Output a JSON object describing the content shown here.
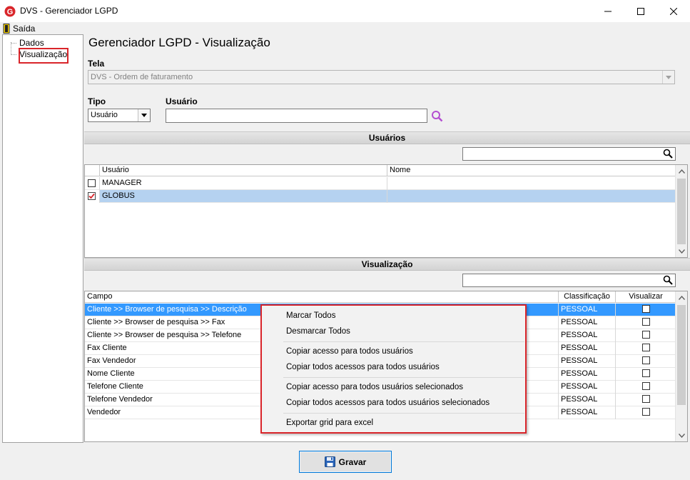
{
  "window": {
    "title": "DVS - Gerenciador LGPD",
    "minimize_icon": "minimize-icon",
    "maximize_icon": "maximize-icon",
    "close_icon": "close-icon",
    "app_icon_letter": "G"
  },
  "menu": {
    "exit_label": "Saída"
  },
  "tree": {
    "items": [
      {
        "label": "Dados"
      },
      {
        "label": "Visualização",
        "selected": true
      }
    ]
  },
  "page_title": "Gerenciador LGPD - Visualização",
  "form": {
    "tela_label": "Tela",
    "tela_value": "DVS - Ordem de faturamento",
    "tipo_label": "Tipo",
    "tipo_value": "Usuário",
    "usuario_label": "Usuário",
    "usuario_value": ""
  },
  "users_section": {
    "title": "Usuários",
    "filter_value": "",
    "columns": [
      "Usuário",
      "Nome"
    ],
    "rows": [
      {
        "checked": false,
        "usuario": "MANAGER",
        "nome": ""
      },
      {
        "checked": true,
        "usuario": "GLOBUS",
        "nome": "",
        "selected": true
      }
    ]
  },
  "view_section": {
    "title": "Visualização",
    "filter_value": "",
    "columns": [
      "Campo",
      "Classificação",
      "Visualizar"
    ],
    "rows": [
      {
        "campo": "Cliente >> Browser de pesquisa >> Descrição",
        "classificacao": "PESSOAL",
        "visualizar": false,
        "selected": true
      },
      {
        "campo": "Cliente >> Browser de pesquisa >> Fax",
        "classificacao": "PESSOAL",
        "visualizar": false
      },
      {
        "campo": "Cliente >> Browser de pesquisa >> Telefone",
        "classificacao": "PESSOAL",
        "visualizar": false
      },
      {
        "campo": "Fax Cliente",
        "classificacao": "PESSOAL",
        "visualizar": false
      },
      {
        "campo": "Fax Vendedor",
        "classificacao": "PESSOAL",
        "visualizar": false
      },
      {
        "campo": "Nome Cliente",
        "classificacao": "PESSOAL",
        "visualizar": false
      },
      {
        "campo": "Telefone Cliente",
        "classificacao": "PESSOAL",
        "visualizar": false
      },
      {
        "campo": "Telefone Vendedor",
        "classificacao": "PESSOAL",
        "visualizar": false
      },
      {
        "campo": "Vendedor",
        "classificacao": "PESSOAL",
        "visualizar": false
      }
    ]
  },
  "context_menu": {
    "items": [
      "Marcar Todos",
      "Desmarcar Todos",
      "Copiar acesso para todos usuários",
      "Copiar todos acessos para todos usuários",
      "Copiar acesso para todos usuários selecionados",
      "Copiar todos acessos para todos usuários selecionados",
      "Exportar grid para excel"
    ]
  },
  "footer": {
    "save_label": "Gravar"
  },
  "colors": {
    "accent": "#d9252a",
    "selection": "#3399ff",
    "search_icon": "#b34fd1"
  }
}
